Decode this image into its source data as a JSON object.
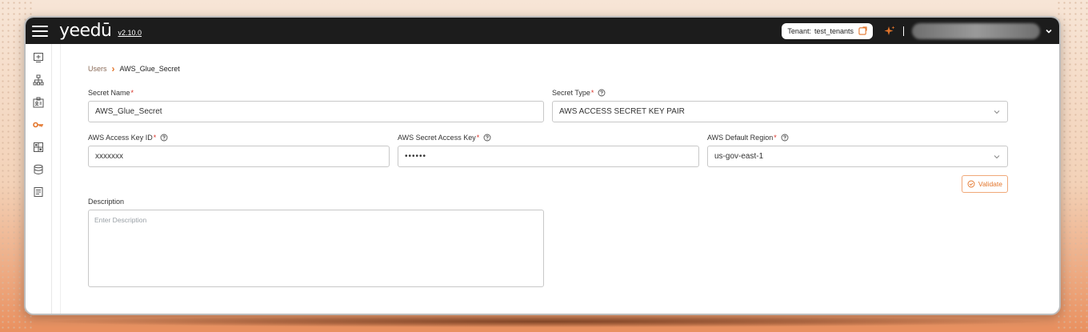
{
  "app": {
    "logo": "yeedū",
    "version": "v2.10.0"
  },
  "header": {
    "tenant_label": "Tenant:",
    "tenant_value": "test_tenants"
  },
  "sidebar": {
    "items": [
      {
        "name": "add-box-icon"
      },
      {
        "name": "hierarchy-icon"
      },
      {
        "name": "id-card-icon"
      },
      {
        "name": "key-icon",
        "active": true
      },
      {
        "name": "grid-icon"
      },
      {
        "name": "database-icon"
      },
      {
        "name": "receipt-icon"
      }
    ]
  },
  "breadcrumb": {
    "parent": "Users",
    "current": "AWS_Glue_Secret"
  },
  "form": {
    "secret_name": {
      "label": "Secret Name",
      "value": "AWS_Glue_Secret"
    },
    "secret_type": {
      "label": "Secret Type",
      "value": "AWS ACCESS SECRET KEY PAIR"
    },
    "access_key_id": {
      "label": "AWS Access Key ID",
      "value": "xxxxxxx"
    },
    "secret_access_key": {
      "label": "AWS Secret Access Key",
      "value": "••••••"
    },
    "default_region": {
      "label": "AWS Default Region",
      "value": "us-gov-east-1"
    },
    "validate_label": "Validate",
    "description": {
      "label": "Description",
      "placeholder": "Enter Description"
    }
  },
  "colors": {
    "accent": "#e3752b",
    "topbar": "#1c1c1c",
    "required": "#d93025"
  }
}
